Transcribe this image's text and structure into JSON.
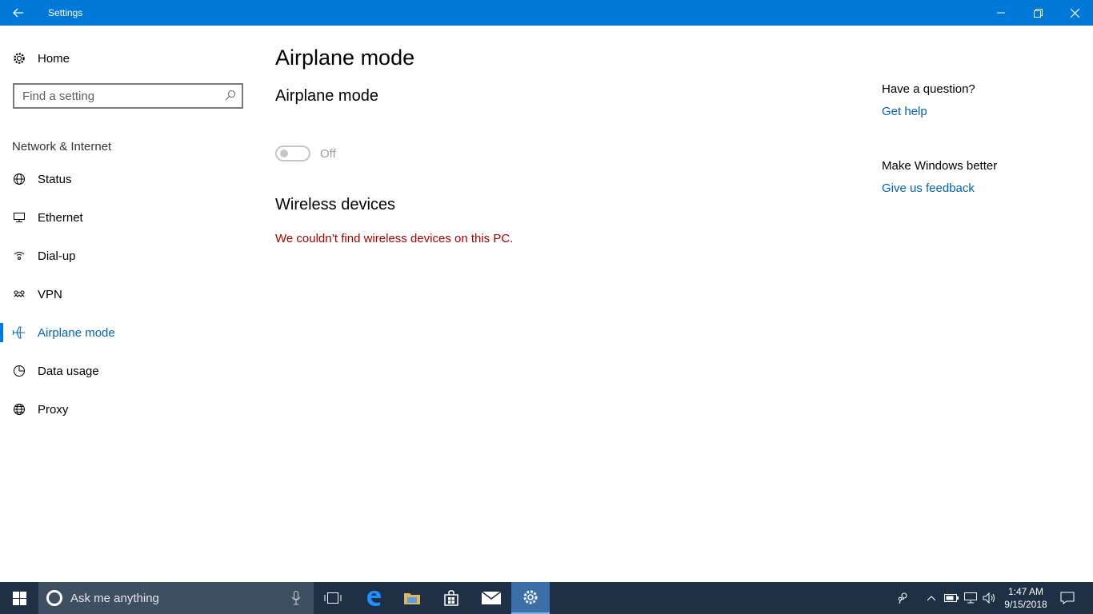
{
  "window": {
    "title": "Settings"
  },
  "sidebar": {
    "home_label": "Home",
    "search_placeholder": "Find a setting",
    "section_title": "Network & Internet",
    "items": [
      {
        "label": "Status",
        "icon": "globe-status-icon"
      },
      {
        "label": "Ethernet",
        "icon": "ethernet-icon"
      },
      {
        "label": "Dial-up",
        "icon": "dialup-icon"
      },
      {
        "label": "VPN",
        "icon": "vpn-icon"
      },
      {
        "label": "Airplane mode",
        "icon": "airplane-icon",
        "active": true
      },
      {
        "label": "Data usage",
        "icon": "pie-icon"
      },
      {
        "label": "Proxy",
        "icon": "globe-icon"
      }
    ]
  },
  "main": {
    "page_title": "Airplane mode",
    "airplane_section_title": "Airplane mode",
    "airplane_toggle_state": "Off",
    "wireless_section_title": "Wireless devices",
    "wireless_error": "We couldn’t find wireless devices on this PC."
  },
  "right": {
    "question_title": "Have a question?",
    "help_link": "Get help",
    "feedback_title": "Make Windows better",
    "feedback_link": "Give us feedback"
  },
  "taskbar": {
    "search_placeholder": "Ask me anything",
    "time": "1:47 AM",
    "date": "9/15/2018"
  },
  "colors": {
    "accent": "#0078d7",
    "error": "#a80000",
    "taskbar": "#1f2f45"
  }
}
